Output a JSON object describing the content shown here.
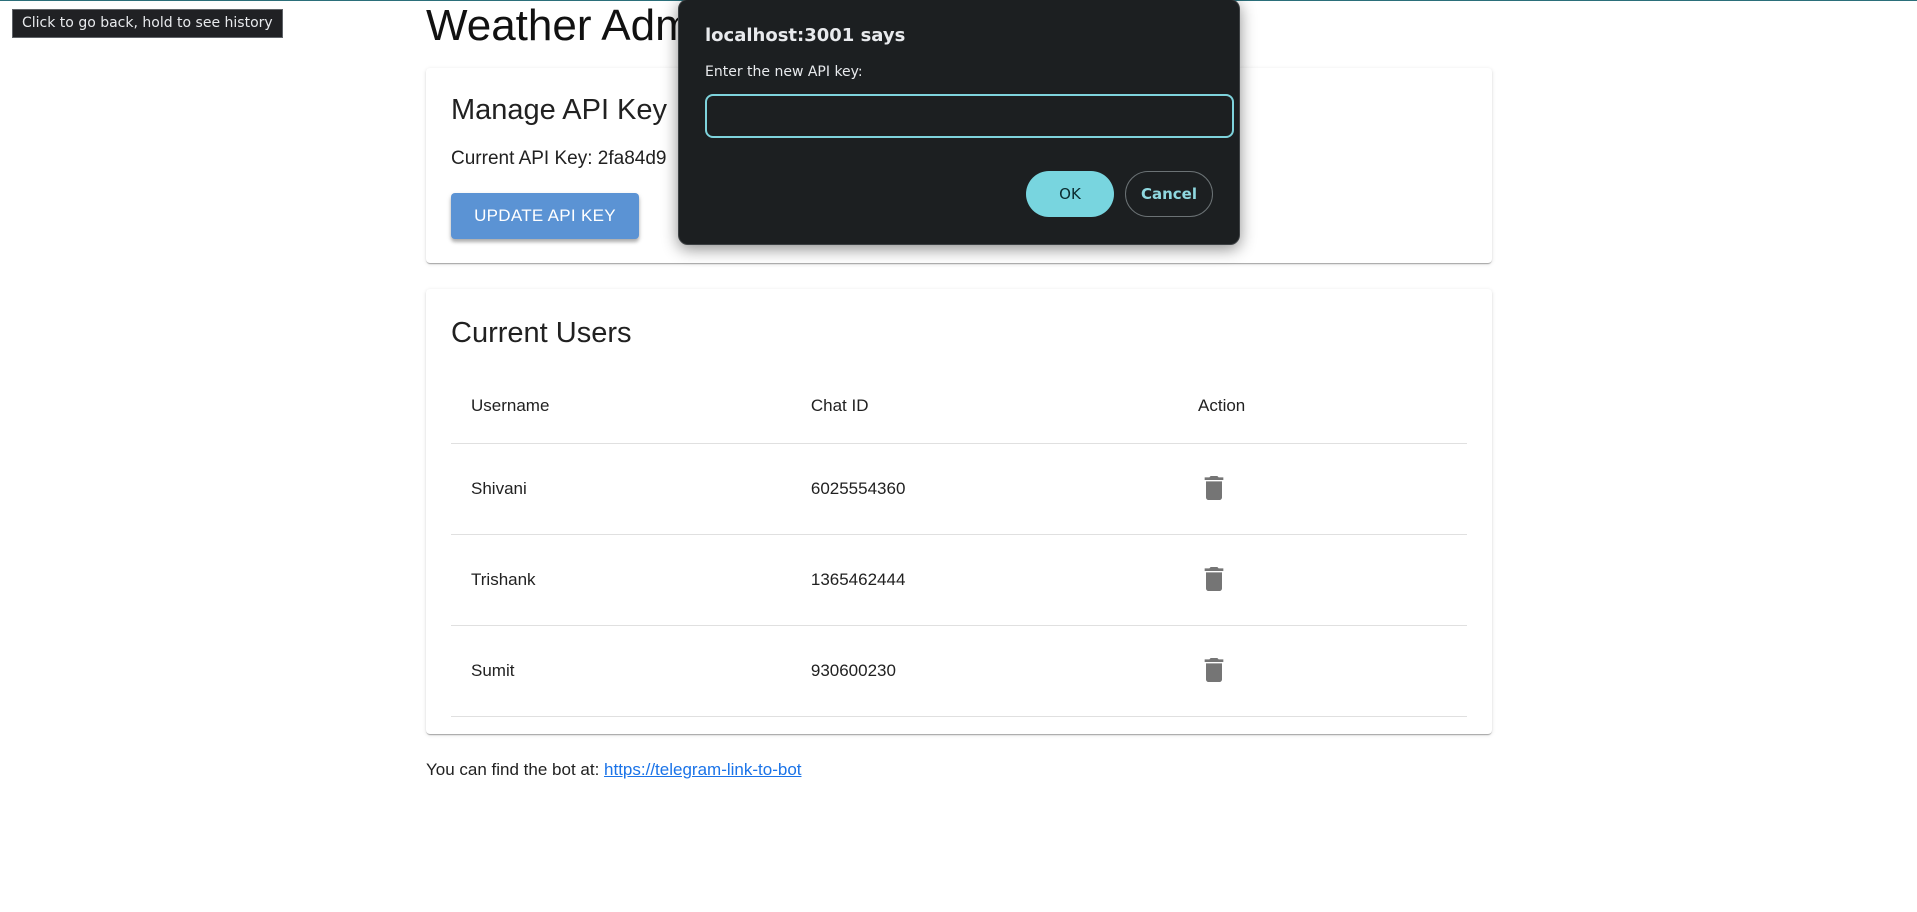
{
  "tooltip": {
    "text": "Click to go back, hold to see history"
  },
  "page": {
    "title": "Weather Admin"
  },
  "api_card": {
    "title": "Manage API Key",
    "current_key_label": "Current API Key:",
    "current_key_value": "2fa84d9",
    "update_button": "UPDATE API KEY"
  },
  "users_card": {
    "title": "Current Users",
    "columns": [
      "Username",
      "Chat ID",
      "Action"
    ],
    "rows": [
      {
        "username": "Shivani",
        "chat_id": "6025554360"
      },
      {
        "username": "Trishank",
        "chat_id": "1365462444"
      },
      {
        "username": "Sumit",
        "chat_id": "930600230"
      }
    ],
    "action_icon": "trash-icon"
  },
  "footer": {
    "text": "You can find the bot at:",
    "link_text": "https://telegram-link-to-bot"
  },
  "dialog": {
    "title": "localhost:3001 says",
    "message": "Enter the new API key:",
    "input_value": "",
    "ok_label": "OK",
    "cancel_label": "Cancel"
  },
  "colors": {
    "primary_button": "#5b93d4",
    "link": "#1a73e8",
    "dialog_bg": "#1c1f21",
    "dialog_accent": "#78d5df"
  }
}
